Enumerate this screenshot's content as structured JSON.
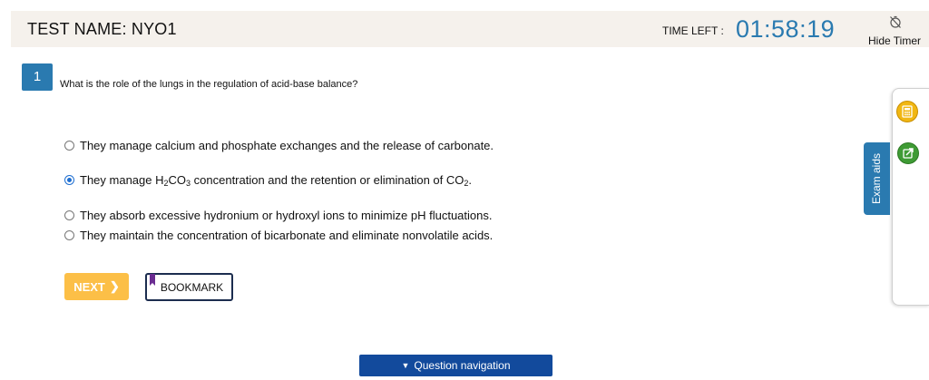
{
  "header": {
    "test_name": "TEST NAME:  NYO1",
    "time_left_label": "TIME LEFT :",
    "time_left_value": "01:58:19",
    "hide_timer_label": "Hide Timer"
  },
  "question": {
    "number": "1",
    "text": "What is the role of the lungs in the regulation of acid-base balance?",
    "options": [
      {
        "text": "They manage calcium and phosphate exchanges and the release of carbonate.",
        "selected": false
      },
      {
        "text_parts": [
          "They manage H",
          "2",
          "CO",
          "3",
          " concentration and the retention or elimination of CO",
          "2",
          "."
        ],
        "selected": true
      },
      {
        "text": "They absorb excessive hydronium or hydroxyl ions to minimize pH fluctuations.",
        "selected": false
      },
      {
        "text": "They maintain the concentration of bicarbonate and eliminate nonvolatile acids.",
        "selected": false
      }
    ]
  },
  "actions": {
    "next_label": "NEXT",
    "next_color": "#fcbf47",
    "bookmark_label": "BOOKMARK"
  },
  "navigation": {
    "question_navigation_label": "Question navigation"
  },
  "exam_aids": {
    "tab_label": "Exam aids",
    "icons": [
      "calculator-icon",
      "external-link-icon"
    ]
  },
  "colors": {
    "accent": "#2a7ab0",
    "nav_bar": "#124a9c",
    "header_bg": "#f5f1ec",
    "bookmark_flag": "#6a2c91"
  }
}
